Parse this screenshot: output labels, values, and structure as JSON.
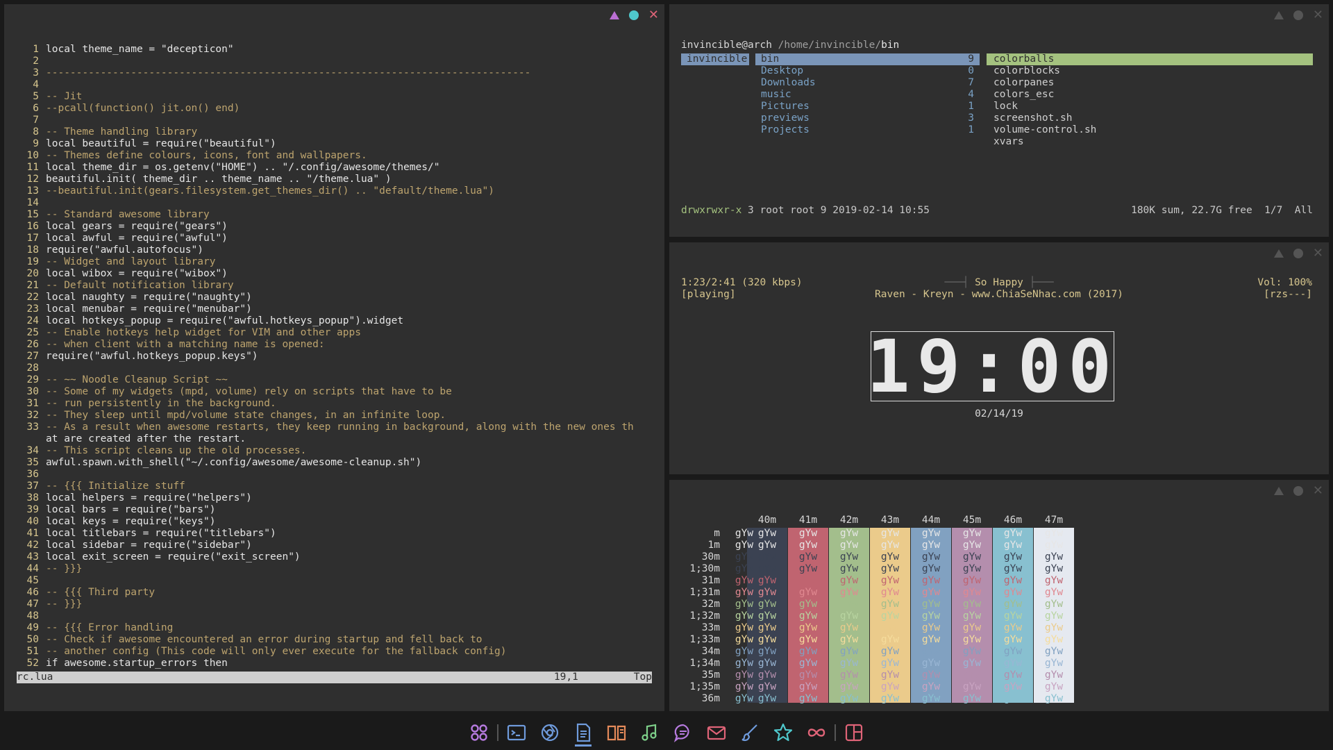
{
  "editor": {
    "lines": [
      {
        "n": "1",
        "t": "local theme_name = \"decepticon\""
      },
      {
        "n": "2",
        "t": ""
      },
      {
        "n": "3",
        "t": "--------------------------------------------------------------------------------"
      },
      {
        "n": "4",
        "t": ""
      },
      {
        "n": "5",
        "t": "-- Jit"
      },
      {
        "n": "6",
        "t": "--pcall(function() jit.on() end)"
      },
      {
        "n": "7",
        "t": ""
      },
      {
        "n": "8",
        "t": "-- Theme handling library"
      },
      {
        "n": "9",
        "t": "local beautiful = require(\"beautiful\")"
      },
      {
        "n": "10",
        "t": "-- Themes define colours, icons, font and wallpapers."
      },
      {
        "n": "11",
        "t": "local theme_dir = os.getenv(\"HOME\") .. \"/.config/awesome/themes/\""
      },
      {
        "n": "12",
        "t": "beautiful.init( theme_dir .. theme_name .. \"/theme.lua\" )"
      },
      {
        "n": "13",
        "t": "--beautiful.init(gears.filesystem.get_themes_dir() .. \"default/theme.lua\")"
      },
      {
        "n": "14",
        "t": ""
      },
      {
        "n": "15",
        "t": "-- Standard awesome library"
      },
      {
        "n": "16",
        "t": "local gears = require(\"gears\")"
      },
      {
        "n": "17",
        "t": "local awful = require(\"awful\")"
      },
      {
        "n": "18",
        "t": "require(\"awful.autofocus\")"
      },
      {
        "n": "19",
        "t": "-- Widget and layout library"
      },
      {
        "n": "20",
        "t": "local wibox = require(\"wibox\")"
      },
      {
        "n": "21",
        "t": "-- Default notification library"
      },
      {
        "n": "22",
        "t": "local naughty = require(\"naughty\")"
      },
      {
        "n": "23",
        "t": "local menubar = require(\"menubar\")"
      },
      {
        "n": "24",
        "t": "local hotkeys_popup = require(\"awful.hotkeys_popup\").widget"
      },
      {
        "n": "25",
        "t": "-- Enable hotkeys help widget for VIM and other apps"
      },
      {
        "n": "26",
        "t": "-- when client with a matching name is opened:"
      },
      {
        "n": "27",
        "t": "require(\"awful.hotkeys_popup.keys\")"
      },
      {
        "n": "28",
        "t": ""
      },
      {
        "n": "29",
        "t": "-- ~~ Noodle Cleanup Script ~~"
      },
      {
        "n": "30",
        "t": "-- Some of my widgets (mpd, volume) rely on scripts that have to be"
      },
      {
        "n": "31",
        "t": "-- run persistently in the background."
      },
      {
        "n": "32",
        "t": "-- They sleep until mpd/volume state changes, in an infinite loop."
      },
      {
        "n": "33",
        "t": "-- As a result when awesome restarts, they keep running in background, along with the new ones th"
      },
      {
        "n": "",
        "t": "at are created after the restart."
      },
      {
        "n": "34",
        "t": "-- This script cleans up the old processes."
      },
      {
        "n": "35",
        "t": "awful.spawn.with_shell(\"~/.config/awesome/awesome-cleanup.sh\")"
      },
      {
        "n": "36",
        "t": ""
      },
      {
        "n": "37",
        "t": "-- {{{ Initialize stuff"
      },
      {
        "n": "38",
        "t": "local helpers = require(\"helpers\")"
      },
      {
        "n": "39",
        "t": "local bars = require(\"bars\")"
      },
      {
        "n": "40",
        "t": "local keys = require(\"keys\")"
      },
      {
        "n": "41",
        "t": "local titlebars = require(\"titlebars\")"
      },
      {
        "n": "42",
        "t": "local sidebar = require(\"sidebar\")"
      },
      {
        "n": "43",
        "t": "local exit_screen = require(\"exit_screen\")"
      },
      {
        "n": "44",
        "t": "-- }}}"
      },
      {
        "n": "45",
        "t": ""
      },
      {
        "n": "46",
        "t": "-- {{{ Third party"
      },
      {
        "n": "47",
        "t": "-- }}}"
      },
      {
        "n": "48",
        "t": ""
      },
      {
        "n": "49",
        "t": "-- {{{ Error handling"
      },
      {
        "n": "50",
        "t": "-- Check if awesome encountered an error during startup and fell back to"
      },
      {
        "n": "51",
        "t": "-- another config (This code will only ever execute for the fallback config)"
      },
      {
        "n": "52",
        "t": "if awesome.startup_errors then"
      }
    ],
    "status_file": "rc.lua",
    "status_pos": "19,1",
    "status_scroll": "Top"
  },
  "filemanager": {
    "prompt_user": "invincible@arch",
    "prompt_path": " /home/invincible/",
    "prompt_dir": "bin",
    "parent": "invincible",
    "dirs": [
      {
        "name": "bin",
        "count": "9"
      },
      {
        "name": "Desktop",
        "count": "0"
      },
      {
        "name": "Downloads",
        "count": "7"
      },
      {
        "name": "music",
        "count": "4"
      },
      {
        "name": "Pictures",
        "count": "1"
      },
      {
        "name": "previews",
        "count": "3"
      },
      {
        "name": "Projects",
        "count": "1"
      }
    ],
    "files": [
      "colorballs",
      "colorblocks",
      "colorpanes",
      "colors_esc",
      "lock",
      "screenshot.sh",
      "volume-control.sh",
      "xvars"
    ],
    "status_perm": "drwxrwxr-x",
    "status_info": " 3 root root 9 2019-02-14 10:55",
    "status_right": "180K sum, 22.7G free  1/7  All"
  },
  "music": {
    "time": "1:23/2:41 (320 kbps)",
    "state": "[playing]",
    "title": "So Happy",
    "artist_line": "Raven - Kreyn - www.ChiaSeNhac.com (2017)",
    "volume": "Vol: 100%",
    "flags": "[rzs---]",
    "clock": "19:00",
    "date": "02/14/19"
  },
  "colors": {
    "headers": [
      "40m",
      "41m",
      "42m",
      "43m",
      "44m",
      "45m",
      "46m",
      "47m"
    ],
    "rows": [
      "m",
      "1m",
      "30m",
      "1;30m",
      "31m",
      "1;31m",
      "32m",
      "1;32m",
      "33m",
      "1;33m",
      "34m",
      "1;34m",
      "35m",
      "1;35m",
      "36m"
    ],
    "sample": "gYw",
    "bg_colors": [
      "#3b4252",
      "#c06470",
      "#a3be8c",
      "#ebcb8b",
      "#81a1c1",
      "#b48ead",
      "#88c0d0",
      "#e5e9f0"
    ],
    "fg_colors": [
      "#e6e6e6",
      "#e6e6e6",
      "#3b4252",
      "#3b4252",
      "#c06470",
      "#e08890",
      "#a3be8c",
      "#b8d4a0",
      "#ebcb8b",
      "#f5dc9c",
      "#81a1c1",
      "#99b6d4",
      "#b48ead",
      "#c8a3c1",
      "#88c0d0"
    ]
  },
  "dock": {
    "icons": [
      "apps-icon",
      "terminal-icon",
      "browser-icon",
      "notes-icon",
      "reader-icon",
      "music-icon",
      "chat-icon",
      "mail-icon",
      "paint-icon",
      "star-icon",
      "infinity-icon",
      "layout-icon"
    ]
  }
}
